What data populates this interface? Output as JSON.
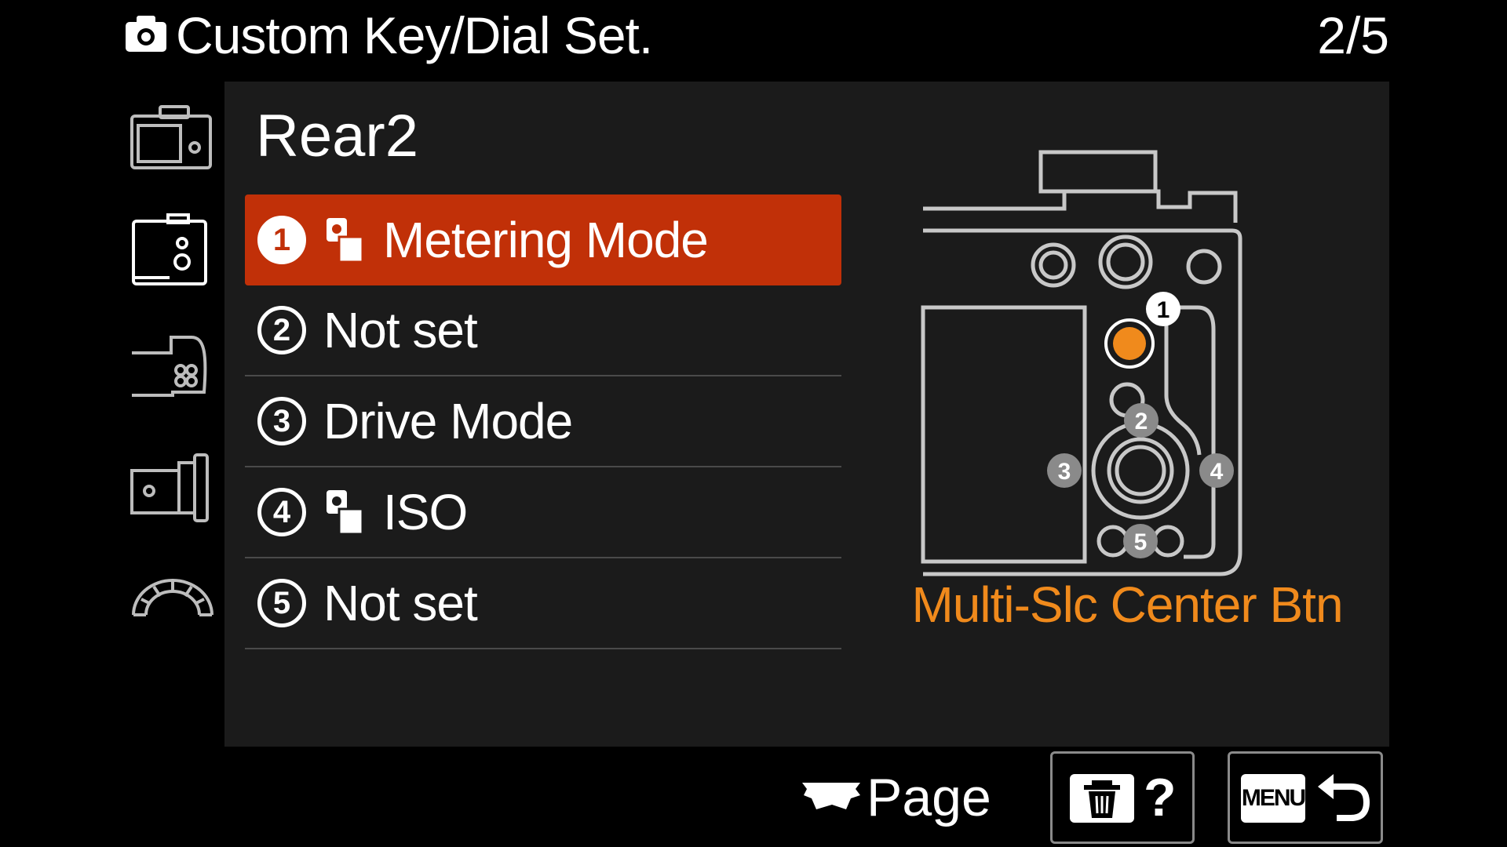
{
  "header": {
    "title": "Custom Key/Dial Set.",
    "page": "2/5",
    "icon": "camera-icon"
  },
  "sidebar": {
    "items": [
      {
        "icon": "camera-body-front-icon"
      },
      {
        "icon": "camera-body-rear-icon"
      },
      {
        "icon": "camera-grip-icon"
      },
      {
        "icon": "camera-lens-side-icon"
      },
      {
        "icon": "dial-icon"
      }
    ]
  },
  "section": {
    "title": "Rear2"
  },
  "list": {
    "items": [
      {
        "number": "1",
        "label": "Metering Mode",
        "icon": "photo-function-icon",
        "selected": true
      },
      {
        "number": "2",
        "label": "Not set",
        "icon": "",
        "selected": false
      },
      {
        "number": "3",
        "label": "Drive Mode",
        "icon": "",
        "selected": false
      },
      {
        "number": "4",
        "label": "ISO",
        "icon": "photo-function-icon",
        "selected": false
      },
      {
        "number": "5",
        "label": "Not set",
        "icon": "",
        "selected": false
      }
    ]
  },
  "illustration": {
    "caption": "Multi-Slc Center Btn",
    "markers": [
      "1",
      "2",
      "3",
      "4",
      "5"
    ],
    "highlight_color": "#f08a1c"
  },
  "footer": {
    "page_label": "Page",
    "help_label": "?",
    "menu_label": "MENU"
  },
  "colors": {
    "selection": "#c13008",
    "accent": "#f08a1c",
    "panel": "#1b1b1b"
  }
}
